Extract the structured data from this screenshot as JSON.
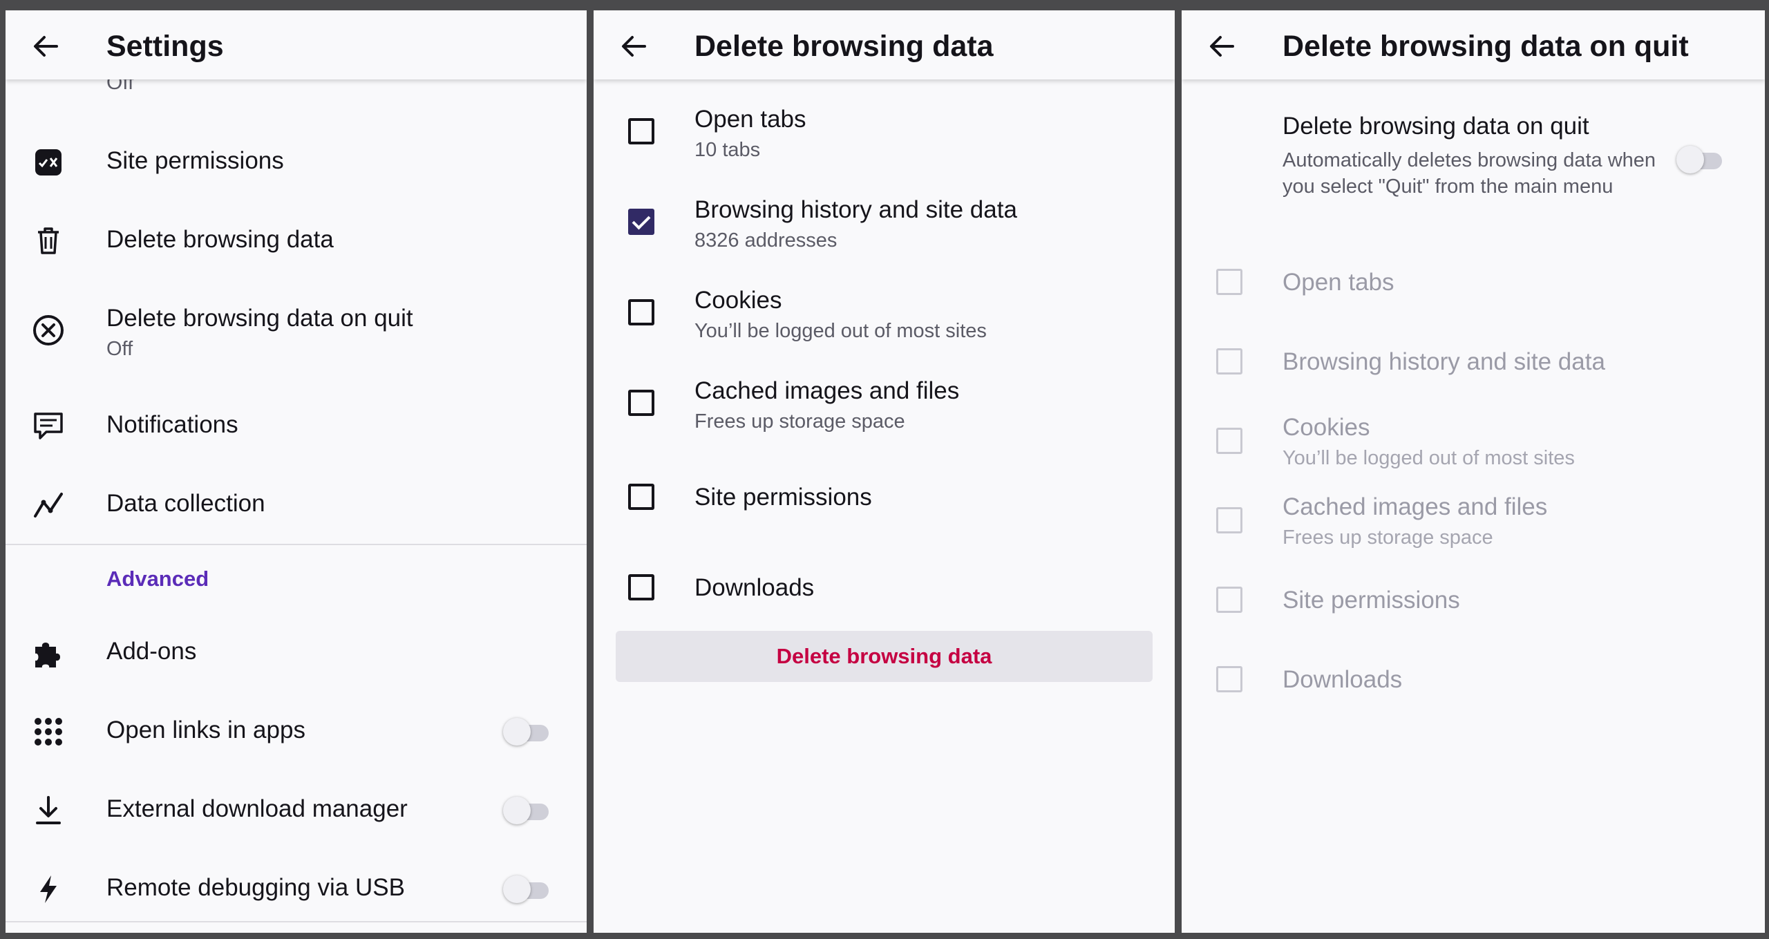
{
  "settings": {
    "title": "Settings",
    "cut_off_text": "Off",
    "items": [
      {
        "label": "Site permissions",
        "icon": "site-permissions-icon"
      },
      {
        "label": "Delete browsing data",
        "icon": "trash-icon"
      },
      {
        "label": "Delete browsing data on quit",
        "sub": "Off",
        "icon": "circle-x-icon"
      },
      {
        "label": "Notifications",
        "icon": "notification-icon"
      },
      {
        "label": "Data collection",
        "icon": "data-chart-icon"
      }
    ],
    "advanced_heading": "Advanced",
    "advanced_items": [
      {
        "label": "Add-ons",
        "icon": "puzzle-icon"
      },
      {
        "label": "Open links in apps",
        "icon": "apps-grid-icon",
        "toggle": false
      },
      {
        "label": "External download manager",
        "icon": "download-icon",
        "toggle": false
      },
      {
        "label": "Remote debugging via USB",
        "icon": "lightning-icon",
        "toggle": false
      }
    ]
  },
  "delete_data": {
    "title": "Delete browsing data",
    "options": [
      {
        "label": "Open tabs",
        "sub": "10 tabs",
        "checked": false
      },
      {
        "label": "Browsing history and site data",
        "sub": "8326 addresses",
        "checked": true
      },
      {
        "label": "Cookies",
        "sub": "You’ll be logged out of most sites",
        "checked": false
      },
      {
        "label": "Cached images and files",
        "sub": "Frees up storage space",
        "checked": false
      },
      {
        "label": "Site permissions",
        "checked": false
      },
      {
        "label": "Downloads",
        "checked": false
      }
    ],
    "button_label": "Delete browsing data"
  },
  "delete_on_quit": {
    "title": "Delete browsing data on quit",
    "toggle_label": "Delete browsing data on quit",
    "toggle_description": "Automatically deletes browsing data when you select \"Quit\" from the main menu",
    "toggle_on": false,
    "options": [
      {
        "label": "Open tabs"
      },
      {
        "label": "Browsing history and site data"
      },
      {
        "label": "Cookies",
        "sub": "You’ll be logged out of most sites"
      },
      {
        "label": "Cached images and files",
        "sub": "Frees up storage space"
      },
      {
        "label": "Site permissions"
      },
      {
        "label": "Downloads"
      }
    ]
  },
  "colors": {
    "accent_purple": "#5b2cb8",
    "checkbox_checked": "#312a65",
    "delete_red": "#c50042"
  }
}
